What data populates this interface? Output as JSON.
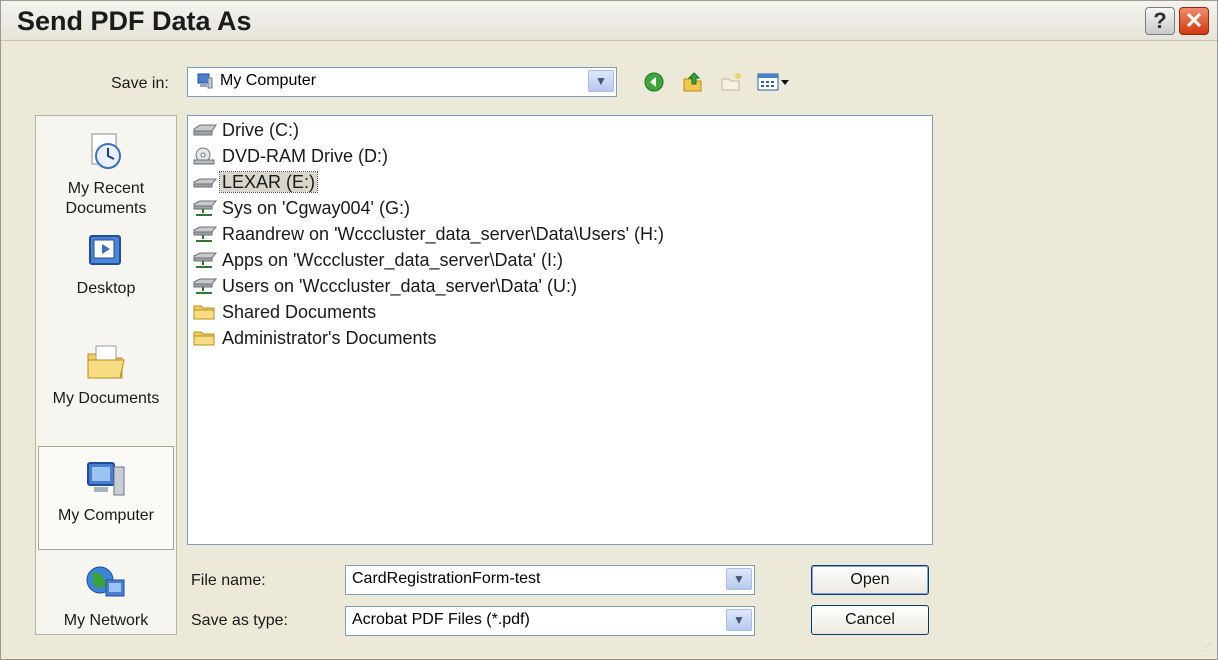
{
  "window": {
    "title": "Send PDF Data As"
  },
  "titlebar_buttons": {
    "help": "?",
    "close": "✕"
  },
  "save_in": {
    "label": "Save in:",
    "value": "My Computer"
  },
  "places": [
    {
      "label1": "My Recent",
      "label2": "Documents"
    },
    {
      "label1": "Desktop",
      "label2": ""
    },
    {
      "label1": "My Documents",
      "label2": ""
    },
    {
      "label1": "My Computer",
      "label2": ""
    },
    {
      "label1": "My Network",
      "label2": ""
    }
  ],
  "files": [
    {
      "name": "Drive (C:)",
      "icon": "hard-drive-icon"
    },
    {
      "name": "DVD-RAM Drive (D:)",
      "icon": "dvd-drive-icon"
    },
    {
      "name": "LEXAR (E:)",
      "icon": "removable-drive-icon"
    },
    {
      "name": "Sys on 'Cgway004' (G:)",
      "icon": "network-drive-icon"
    },
    {
      "name": "Raandrew on 'Wcccluster_data_server\\Data\\Users' (H:)",
      "icon": "network-drive-icon"
    },
    {
      "name": "Apps on 'Wcccluster_data_server\\Data' (I:)",
      "icon": "network-drive-icon"
    },
    {
      "name": "Users on 'Wcccluster_data_server\\Data' (U:)",
      "icon": "network-drive-icon"
    },
    {
      "name": "Shared Documents",
      "icon": "folder-icon"
    },
    {
      "name": "Administrator's Documents",
      "icon": "folder-icon"
    }
  ],
  "file_name": {
    "label": "File name:",
    "value": "CardRegistrationForm-test"
  },
  "save_as_type": {
    "label": "Save as type:",
    "value": "Acrobat PDF Files (*.pdf)"
  },
  "buttons": {
    "open": "Open",
    "cancel": "Cancel"
  },
  "colors": {
    "selected_row": "#d9d7cc",
    "dialog_bg": "#ece9d8",
    "close_red": "#d03a10"
  }
}
